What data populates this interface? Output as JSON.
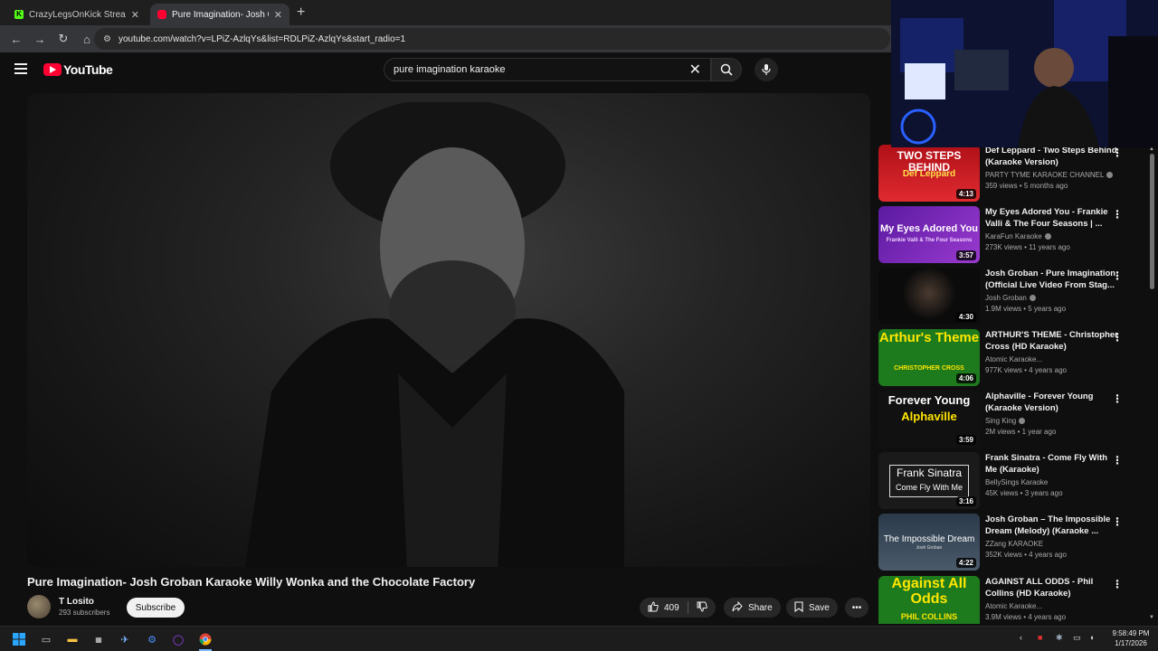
{
  "browser": {
    "tabs": [
      {
        "title": "CrazyLegsOnKick Stream - Wat",
        "active": false
      },
      {
        "title": "Pure Imagination- Josh Groban",
        "active": true
      }
    ],
    "url": "youtube.com/watch?v=LPiZ-AzlqYs&list=RDLPiZ-AzlqYs&start_radio=1"
  },
  "youtube": {
    "logo_text": "YouTube",
    "search_query": "pure imagination karaoke"
  },
  "video": {
    "title": "Pure Imagination- Josh Groban Karaoke Willy Wonka and the Chocolate Factory",
    "channel": "T Losito",
    "subscribers": "293 subscribers",
    "subscribe_label": "Subscribe",
    "likes": "409",
    "share_label": "Share",
    "save_label": "Save"
  },
  "sidebar": {
    "items": [
      {
        "title": "Def Leppard - Two Steps Behind (Karaoke Version)",
        "channel": "PARTY TYME KARAOKE CHANNEL",
        "verified": true,
        "stats": "359 views • 5 months ago",
        "duration": "4:13",
        "thumb_top": "TWO STEPS BEHIND",
        "thumb_bottom": "Def Leppard",
        "thumb_color": "#c0161e"
      },
      {
        "title": "My Eyes Adored You - Frankie Valli & The Four Seasons | ...",
        "channel": "KaraFun Karaoke",
        "verified": true,
        "stats": "273K views • 11 years ago",
        "duration": "3:57",
        "thumb_top": "My Eyes Adored You",
        "thumb_bottom": "Frankie Valli & The Four Seasons",
        "thumb_color": "#6d1fb0"
      },
      {
        "title": "Josh Groban - Pure Imagination (Official Live Video From Stag...",
        "channel": "Josh Groban",
        "verified": true,
        "stats": "1.9M views • 5 years ago",
        "duration": "4:30",
        "thumb_top": "",
        "thumb_bottom": "",
        "thumb_color": "#0b0b0b"
      },
      {
        "title": "ARTHUR'S THEME - Christopher Cross (HD Karaoke)",
        "channel": "Atomic Karaoke...",
        "verified": false,
        "stats": "977K views • 4 years ago",
        "duration": "4:06",
        "thumb_top": "Arthur's Theme",
        "thumb_bottom": "CHRISTOPHER CROSS",
        "thumb_color": "#1d7a1d"
      },
      {
        "title": "Alphaville - Forever Young (Karaoke Version)",
        "channel": "Sing King",
        "verified": true,
        "stats": "2M views • 1 year ago",
        "duration": "3:59",
        "thumb_top": "Forever Young",
        "thumb_bottom": "Alphaville",
        "thumb_color": "#111111"
      },
      {
        "title": "Frank Sinatra - Come Fly With Me (Karaoke)",
        "channel": "BellySings Karaoke",
        "verified": false,
        "stats": "45K views • 3 years ago",
        "duration": "3:16",
        "thumb_top": "Frank Sinatra",
        "thumb_bottom": "Come Fly With Me",
        "thumb_color": "#1a1a1a"
      },
      {
        "title": "Josh Groban – The Impossible Dream (Melody) (Karaoke ...",
        "channel": "ZZang KARAOKE",
        "verified": false,
        "stats": "352K views • 4 years ago",
        "duration": "4:22",
        "thumb_top": "The Impossible Dream",
        "thumb_bottom": "Josh Groban",
        "thumb_color": "#3a4a5a"
      },
      {
        "title": "AGAINST ALL ODDS - Phil Collins (HD Karaoke)",
        "channel": "Atomic Karaoke...",
        "verified": false,
        "stats": "3.9M views • 4 years ago",
        "duration": "",
        "thumb_top": "Against All Odds",
        "thumb_bottom": "PHIL COLLINS",
        "thumb_color": "#1d7a1d"
      }
    ]
  },
  "taskbar": {
    "time": "9:58:49 PM",
    "date": "1/17/2026"
  }
}
